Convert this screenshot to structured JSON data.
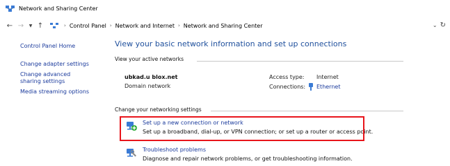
{
  "window": {
    "title": "Network and Sharing Center"
  },
  "address": {
    "breadcrumbs": [
      "Control Panel",
      "Network and Internet",
      "Network and Sharing Center"
    ]
  },
  "sidebar": {
    "home": "Control Panel Home",
    "items": [
      {
        "label": "Change adapter settings"
      },
      {
        "label": "Change advanced sharing settings"
      },
      {
        "label": "Media streaming options"
      }
    ]
  },
  "main": {
    "heading": "View your basic network information and set up connections",
    "active_networks_label": "View your active networks",
    "network": {
      "name": "ubkad.u blox.net",
      "category": "Domain network",
      "access_type_label": "Access type:",
      "access_type_value": "Internet",
      "connections_label": "Connections:",
      "connections_value": "Ethernet"
    },
    "change_settings_label": "Change your networking settings",
    "tasks": [
      {
        "link": "Set up a new connection or network",
        "description": "Set up a broadband, dial-up, or VPN connection; or set up a router or access point.",
        "icon": "network-setup-icon"
      },
      {
        "link": "Troubleshoot problems",
        "description": "Diagnose and repair network problems, or get troubleshooting information.",
        "icon": "troubleshoot-icon"
      }
    ]
  },
  "colors": {
    "link": "#1a3a9c",
    "heading": "#1e4f9c",
    "highlight": "#e8141a"
  }
}
